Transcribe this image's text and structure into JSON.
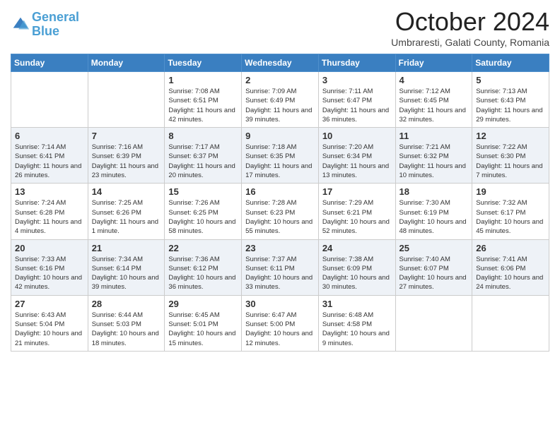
{
  "header": {
    "logo_line1": "General",
    "logo_line2": "Blue",
    "month": "October 2024",
    "location": "Umbraresti, Galati County, Romania"
  },
  "weekdays": [
    "Sunday",
    "Monday",
    "Tuesday",
    "Wednesday",
    "Thursday",
    "Friday",
    "Saturday"
  ],
  "weeks": [
    [
      {
        "day": "",
        "info": ""
      },
      {
        "day": "",
        "info": ""
      },
      {
        "day": "1",
        "info": "Sunrise: 7:08 AM\nSunset: 6:51 PM\nDaylight: 11 hours and 42 minutes."
      },
      {
        "day": "2",
        "info": "Sunrise: 7:09 AM\nSunset: 6:49 PM\nDaylight: 11 hours and 39 minutes."
      },
      {
        "day": "3",
        "info": "Sunrise: 7:11 AM\nSunset: 6:47 PM\nDaylight: 11 hours and 36 minutes."
      },
      {
        "day": "4",
        "info": "Sunrise: 7:12 AM\nSunset: 6:45 PM\nDaylight: 11 hours and 32 minutes."
      },
      {
        "day": "5",
        "info": "Sunrise: 7:13 AM\nSunset: 6:43 PM\nDaylight: 11 hours and 29 minutes."
      }
    ],
    [
      {
        "day": "6",
        "info": "Sunrise: 7:14 AM\nSunset: 6:41 PM\nDaylight: 11 hours and 26 minutes."
      },
      {
        "day": "7",
        "info": "Sunrise: 7:16 AM\nSunset: 6:39 PM\nDaylight: 11 hours and 23 minutes."
      },
      {
        "day": "8",
        "info": "Sunrise: 7:17 AM\nSunset: 6:37 PM\nDaylight: 11 hours and 20 minutes."
      },
      {
        "day": "9",
        "info": "Sunrise: 7:18 AM\nSunset: 6:35 PM\nDaylight: 11 hours and 17 minutes."
      },
      {
        "day": "10",
        "info": "Sunrise: 7:20 AM\nSunset: 6:34 PM\nDaylight: 11 hours and 13 minutes."
      },
      {
        "day": "11",
        "info": "Sunrise: 7:21 AM\nSunset: 6:32 PM\nDaylight: 11 hours and 10 minutes."
      },
      {
        "day": "12",
        "info": "Sunrise: 7:22 AM\nSunset: 6:30 PM\nDaylight: 11 hours and 7 minutes."
      }
    ],
    [
      {
        "day": "13",
        "info": "Sunrise: 7:24 AM\nSunset: 6:28 PM\nDaylight: 11 hours and 4 minutes."
      },
      {
        "day": "14",
        "info": "Sunrise: 7:25 AM\nSunset: 6:26 PM\nDaylight: 11 hours and 1 minute."
      },
      {
        "day": "15",
        "info": "Sunrise: 7:26 AM\nSunset: 6:25 PM\nDaylight: 10 hours and 58 minutes."
      },
      {
        "day": "16",
        "info": "Sunrise: 7:28 AM\nSunset: 6:23 PM\nDaylight: 10 hours and 55 minutes."
      },
      {
        "day": "17",
        "info": "Sunrise: 7:29 AM\nSunset: 6:21 PM\nDaylight: 10 hours and 52 minutes."
      },
      {
        "day": "18",
        "info": "Sunrise: 7:30 AM\nSunset: 6:19 PM\nDaylight: 10 hours and 48 minutes."
      },
      {
        "day": "19",
        "info": "Sunrise: 7:32 AM\nSunset: 6:17 PM\nDaylight: 10 hours and 45 minutes."
      }
    ],
    [
      {
        "day": "20",
        "info": "Sunrise: 7:33 AM\nSunset: 6:16 PM\nDaylight: 10 hours and 42 minutes."
      },
      {
        "day": "21",
        "info": "Sunrise: 7:34 AM\nSunset: 6:14 PM\nDaylight: 10 hours and 39 minutes."
      },
      {
        "day": "22",
        "info": "Sunrise: 7:36 AM\nSunset: 6:12 PM\nDaylight: 10 hours and 36 minutes."
      },
      {
        "day": "23",
        "info": "Sunrise: 7:37 AM\nSunset: 6:11 PM\nDaylight: 10 hours and 33 minutes."
      },
      {
        "day": "24",
        "info": "Sunrise: 7:38 AM\nSunset: 6:09 PM\nDaylight: 10 hours and 30 minutes."
      },
      {
        "day": "25",
        "info": "Sunrise: 7:40 AM\nSunset: 6:07 PM\nDaylight: 10 hours and 27 minutes."
      },
      {
        "day": "26",
        "info": "Sunrise: 7:41 AM\nSunset: 6:06 PM\nDaylight: 10 hours and 24 minutes."
      }
    ],
    [
      {
        "day": "27",
        "info": "Sunrise: 6:43 AM\nSunset: 5:04 PM\nDaylight: 10 hours and 21 minutes."
      },
      {
        "day": "28",
        "info": "Sunrise: 6:44 AM\nSunset: 5:03 PM\nDaylight: 10 hours and 18 minutes."
      },
      {
        "day": "29",
        "info": "Sunrise: 6:45 AM\nSunset: 5:01 PM\nDaylight: 10 hours and 15 minutes."
      },
      {
        "day": "30",
        "info": "Sunrise: 6:47 AM\nSunset: 5:00 PM\nDaylight: 10 hours and 12 minutes."
      },
      {
        "day": "31",
        "info": "Sunrise: 6:48 AM\nSunset: 4:58 PM\nDaylight: 10 hours and 9 minutes."
      },
      {
        "day": "",
        "info": ""
      },
      {
        "day": "",
        "info": ""
      }
    ]
  ]
}
